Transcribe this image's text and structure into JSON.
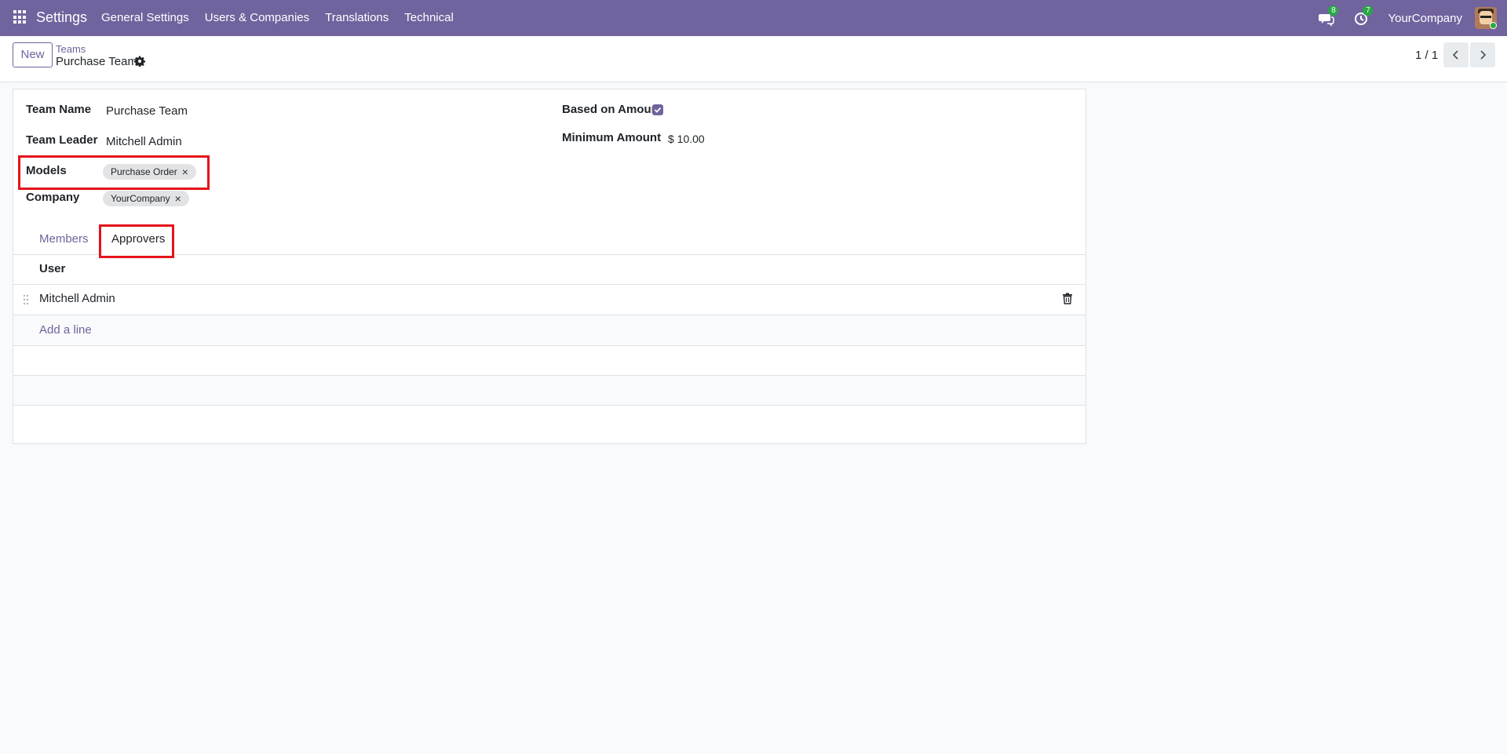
{
  "navbar": {
    "brand": "Settings",
    "menu": [
      "General Settings",
      "Users & Companies",
      "Translations",
      "Technical"
    ],
    "messages_badge": "8",
    "activities_badge": "7",
    "company": "YourCompany"
  },
  "control_panel": {
    "new_label": "New",
    "breadcrumb_parent": "Teams",
    "breadcrumb_current": "Purchase Team",
    "pager": "1 / 1"
  },
  "form": {
    "team_name_label": "Team Name",
    "team_name": "Purchase Team",
    "team_leader_label": "Team Leader",
    "team_leader": "Mitchell Admin",
    "models_label": "Models",
    "models_tag": "Purchase Order",
    "company_label": "Company",
    "company_tag": "YourCompany",
    "based_on_amount_label": "Based on Amount",
    "based_on_amount": true,
    "minimum_amount_label": "Minimum Amount",
    "minimum_amount": "$ 10.00"
  },
  "tabs": {
    "members": "Members",
    "approvers": "Approvers",
    "active": "Approvers"
  },
  "approvers_list": {
    "column_user": "User",
    "rows": [
      {
        "user": "Mitchell Admin"
      }
    ],
    "add_line": "Add a line"
  },
  "colors": {
    "navbar": "#71639e",
    "accent": "#71639e",
    "highlight": "#e5131a",
    "badge": "#28a745"
  }
}
